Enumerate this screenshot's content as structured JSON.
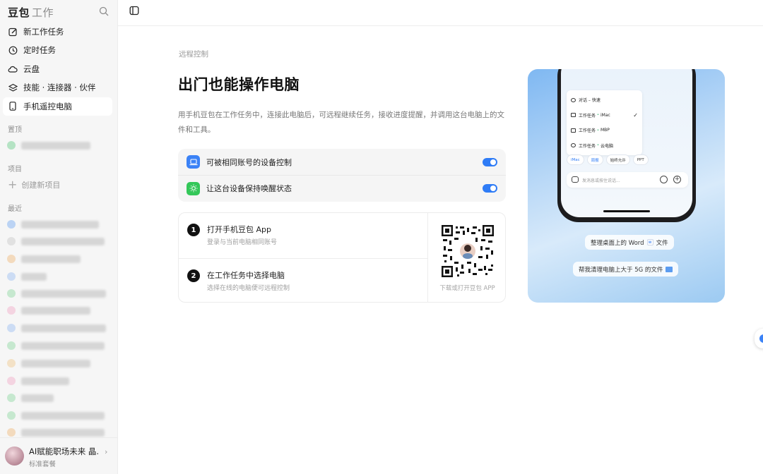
{
  "sidebar": {
    "brand": "豆包",
    "brand_sub": "工作",
    "nav": [
      {
        "label": "新工作任务",
        "icon": "edit-icon"
      },
      {
        "label": "定时任务",
        "icon": "clock-icon"
      },
      {
        "label": "云盘",
        "icon": "cloud-icon"
      },
      {
        "label": "技能 · 连接器 · 伙伴",
        "icon": "layers-icon"
      },
      {
        "label": "手机遥控电脑",
        "icon": "phone-icon"
      }
    ],
    "sections": {
      "pinned": "置顶",
      "projects": "项目",
      "recent": "最近"
    },
    "new_project": "创建新项目",
    "user": {
      "name": "AI赋能职场未来 晶...",
      "plan": "标准套餐"
    }
  },
  "main": {
    "breadcrumb": "远程控制",
    "title": "出门也能操作电脑",
    "description": "用手机豆包在工作任务中，连接此电脑后，可远程继续任务，接收进度提醒，并调用这台电脑上的文件和工具。",
    "settings": [
      {
        "label": "可被相同账号的设备控制",
        "enabled": true,
        "icon_color": "#3b82f6"
      },
      {
        "label": "让这台设备保持唤醒状态",
        "enabled": true,
        "icon_color": "#34c759"
      }
    ],
    "steps": [
      {
        "num": "1",
        "title": "打开手机豆包 App",
        "sub": "登录与当前电脑相同账号"
      },
      {
        "num": "2",
        "title": "在工作任务中选择电脑",
        "sub": "选择在线的电脑便可远程控制"
      }
    ],
    "qr_caption": "下载或打开豆包 APP"
  },
  "promo": {
    "menu": [
      {
        "pre": "对话 – 快速",
        "dot": "",
        "post": "",
        "checked": false
      },
      {
        "pre": "工作任务",
        "dot": "•",
        "post": "iMac",
        "checked": true
      },
      {
        "pre": "工作任务",
        "dot": "•",
        "post": "MBP",
        "checked": false
      },
      {
        "pre": "工作任务",
        "dot": "•",
        "post": "云电脑",
        "checked": false
      }
    ],
    "chips": [
      "iMac",
      "周报",
      "始终允许",
      "PPT"
    ],
    "input_placeholder": "发消息或按住说话...",
    "bubble1_pre": "整理桌面上的 Word",
    "bubble1_post": "文件",
    "bubble2": "帮我清理电脑上大于 5G 的文件"
  },
  "colors": {
    "accent": "#2f7cf6",
    "toggle_on": "#2f7cf6"
  }
}
